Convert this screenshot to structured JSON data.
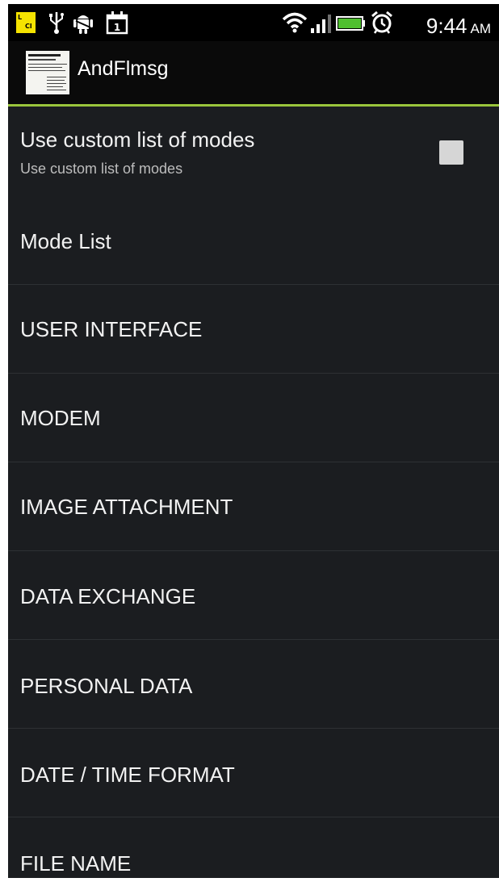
{
  "status_bar": {
    "time": "9:44",
    "ampm": "AM",
    "left_icons": [
      "notification-app-icon",
      "usb-icon",
      "android-debug-icon",
      "calendar-icon"
    ],
    "right_icons": [
      "wifi-icon",
      "signal-icon",
      "battery-icon",
      "alarm-icon"
    ],
    "calendar_day": "1"
  },
  "action_bar": {
    "title": "AndFlmsg",
    "accent_color": "#9ac53c"
  },
  "preferences": {
    "custom_modes": {
      "title": "Use custom list of modes",
      "summary": "Use custom list of modes",
      "checked": false
    },
    "items": [
      {
        "label": "Mode List"
      },
      {
        "label": "USER INTERFACE"
      },
      {
        "label": "MODEM"
      },
      {
        "label": "IMAGE ATTACHMENT"
      },
      {
        "label": "DATA EXCHANGE"
      },
      {
        "label": "PERSONAL DATA"
      },
      {
        "label": "DATE / TIME FORMAT"
      },
      {
        "label": "FILE NAME"
      }
    ]
  }
}
